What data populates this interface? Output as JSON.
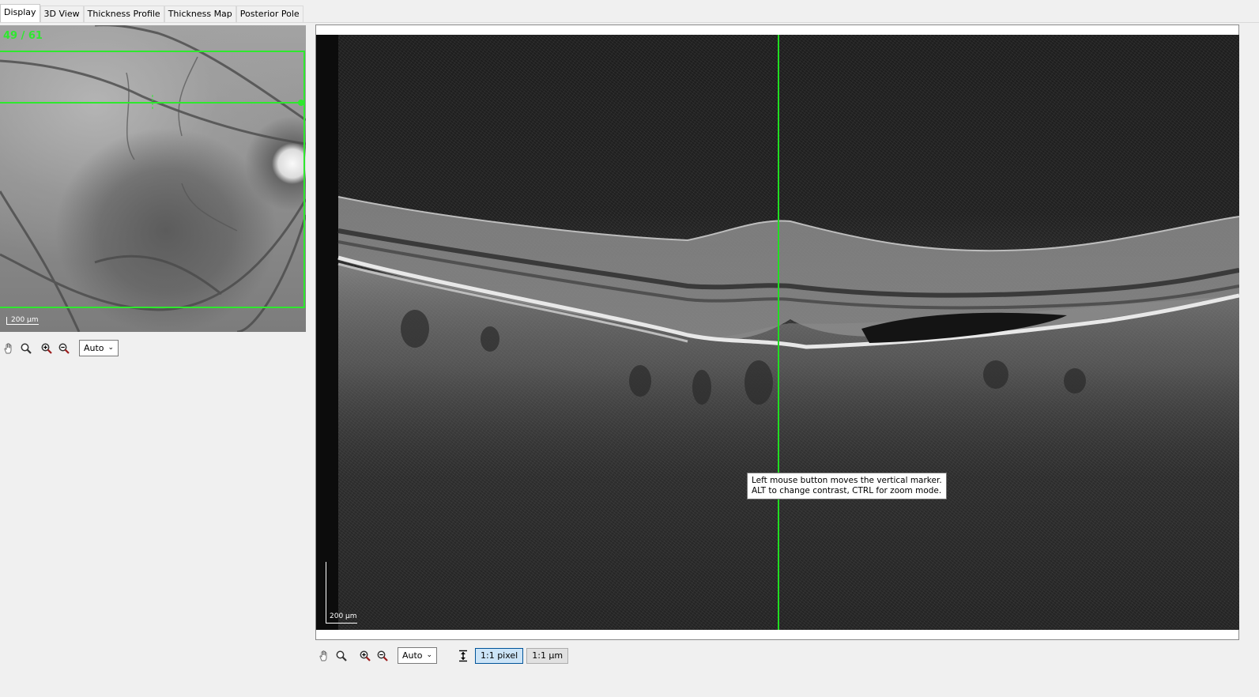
{
  "tabs": [
    {
      "label": "Display",
      "active": true
    },
    {
      "label": "3D View",
      "active": false
    },
    {
      "label": "Thickness Profile",
      "active": false
    },
    {
      "label": "Thickness Map",
      "active": false
    },
    {
      "label": "Posterior Pole",
      "active": false
    }
  ],
  "fundus": {
    "slice_counter": "49 / 61",
    "scale_label": "200 µm",
    "marker_color": "#2ee82e"
  },
  "fundus_toolbar": {
    "zoom_select": "Auto"
  },
  "oct": {
    "scale_label": "200 µm",
    "tooltip_line1": "Left mouse button moves the vertical marker.",
    "tooltip_line2": "ALT to change contrast, CTRL for zoom mode.",
    "marker_color": "#22dd22"
  },
  "oct_toolbar": {
    "zoom_select": "Auto",
    "pixel_button": "1:1 pixel",
    "micron_button": "1:1 µm"
  },
  "icons": [
    "hand-pan-icon",
    "magnifier-icon",
    "zoom-in-icon",
    "zoom-out-icon",
    "fit-height-icon",
    "chevron-down-icon"
  ]
}
